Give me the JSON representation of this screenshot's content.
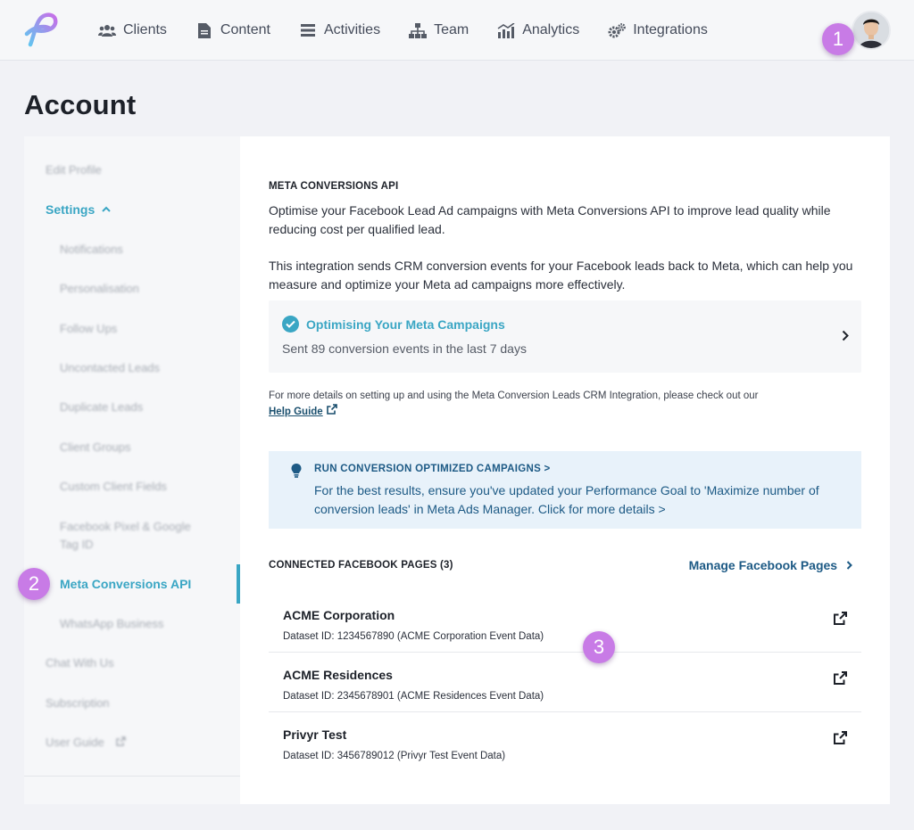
{
  "nav": {
    "items": [
      {
        "label": "Clients",
        "icon": "users-icon"
      },
      {
        "label": "Content",
        "icon": "document-icon"
      },
      {
        "label": "Activities",
        "icon": "list-icon"
      },
      {
        "label": "Team",
        "icon": "org-chart-icon"
      },
      {
        "label": "Analytics",
        "icon": "analytics-icon"
      },
      {
        "label": "Integrations",
        "icon": "gears-icon"
      }
    ]
  },
  "badges": {
    "one": "1",
    "two": "2",
    "three": "3"
  },
  "page": {
    "title": "Account"
  },
  "sidebar": {
    "edit_profile": "Edit Profile",
    "settings": "Settings",
    "sub_items": [
      "Notifications",
      "Personalisation",
      "Follow Ups",
      "Uncontacted Leads",
      "Duplicate Leads",
      "Client Groups",
      "Custom Client Fields",
      "Facebook Pixel & Google",
      "Tag ID"
    ],
    "active": "Meta Conversions API",
    "whatsapp": "WhatsApp Business",
    "chat": "Chat With Us",
    "subscription": "Subscription",
    "user_guide": "User Guide"
  },
  "main": {
    "section_title": "META CONVERSIONS API",
    "intro": "Optimise your Facebook Lead Ad campaigns with Meta Conversions API to improve lead quality while reducing cost per qualified lead.",
    "description": "This integration sends CRM conversion events for your Facebook leads back to Meta, which can help you measure and optimize your Meta ad campaigns more effectively.",
    "status": {
      "title": "Optimising Your Meta Campaigns",
      "subtitle": "Sent 89 conversion events in the last 7 days"
    },
    "note": "For more details on setting up and using the Meta Conversion Leads CRM Integration, please check out our",
    "help_link": "Help Guide",
    "tip": {
      "title": "RUN CONVERSION OPTIMIZED CAMPAIGNS >",
      "body": "For the best results, ensure you've updated your Performance Goal to 'Maximize number of conversion leads' in Meta Ads Manager. Click for more details >"
    },
    "pages_heading": "CONNECTED FACEBOOK PAGES (3)",
    "manage_link": "Manage Facebook Pages",
    "pages": [
      {
        "name": "ACME Corporation",
        "dataset": "Dataset ID: 1234567890 (ACME Corporation Event Data)"
      },
      {
        "name": "ACME Residences",
        "dataset": "Dataset ID: 2345678901 (ACME Residences Event Data)"
      },
      {
        "name": "Privyr Test",
        "dataset": "Dataset ID: 3456789012 (Privyr Test Event Data)"
      }
    ]
  },
  "colors": {
    "accent": "#3aa6c4",
    "link": "#1d5a85",
    "badge": "#c87be6",
    "tip_bg": "#e8f2fa"
  }
}
